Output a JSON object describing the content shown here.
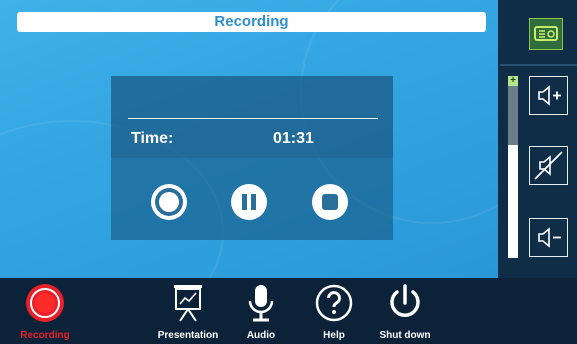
{
  "header": {
    "title": "Recording"
  },
  "recorder": {
    "time_label": "Time:",
    "time_value": "01:31"
  },
  "volume": {
    "plus_marker": "+",
    "level": 0.62
  },
  "nav": {
    "recording": "Recording",
    "presentation": "Presentation",
    "audio": "Audio",
    "help": "Help",
    "shutdown": "Shut down"
  },
  "colors": {
    "accent": "#2e8fd0",
    "active_red": "#e8202a",
    "projector_green": "#8ec63f"
  }
}
